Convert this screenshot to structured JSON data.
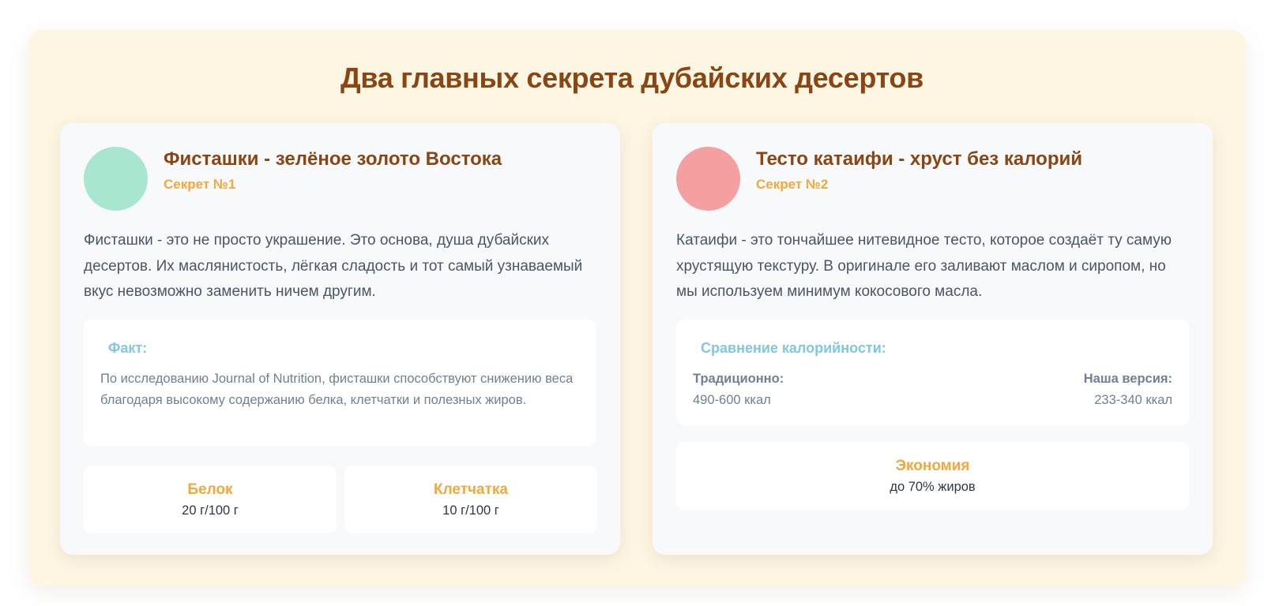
{
  "page": {
    "title": "Два главных секрета дубайских десертов"
  },
  "colors": {
    "title": "#8b4513",
    "accent": "#f5a83a",
    "heading_blue": "#7ec8e3",
    "circle_green": "#a8e6cf",
    "circle_red": "#f4a0a1",
    "background": "#fdf6e3"
  },
  "cards": [
    {
      "icon": "green-circle",
      "title": "Фисташки - зелёное золото Востока",
      "subtitle": "Секрет №1",
      "text": "Фисташки - это не просто украшение. Это основа, душа дубайских десертов. Их маслянистость, лёгкая сладость и тот самый узнаваемый вкус невозможно заменить ничем другим.",
      "fact": {
        "heading": "Факт:",
        "text": "По исследованию Journal of Nutrition, фисташки способствуют снижению веса благодаря высокому содержанию белка, клетчатки и полезных жиров."
      },
      "stats": [
        {
          "label": "Белок",
          "value": "20 г/100 г"
        },
        {
          "label": "Клетчатка",
          "value": "10 г/100 г"
        }
      ]
    },
    {
      "icon": "red-circle",
      "title": "Тесто катаифи - хруст без калорий",
      "subtitle": "Секрет №2",
      "text": "Катаифи - это тончайшее нитевидное тесто, которое создаёт ту самую хрустящую текстуру. В оригинале его заливают маслом и сиропом, но мы используем минимум кокосового масла.",
      "comparison": {
        "heading": "Сравнение калорийности:",
        "left_label": "Традиционно:",
        "left_value": "490-600 ккал",
        "right_label": "Наша версия:",
        "right_value": "233-340 ккал"
      },
      "economy": {
        "label": "Экономия",
        "value": "до 70% жиров"
      }
    }
  ]
}
